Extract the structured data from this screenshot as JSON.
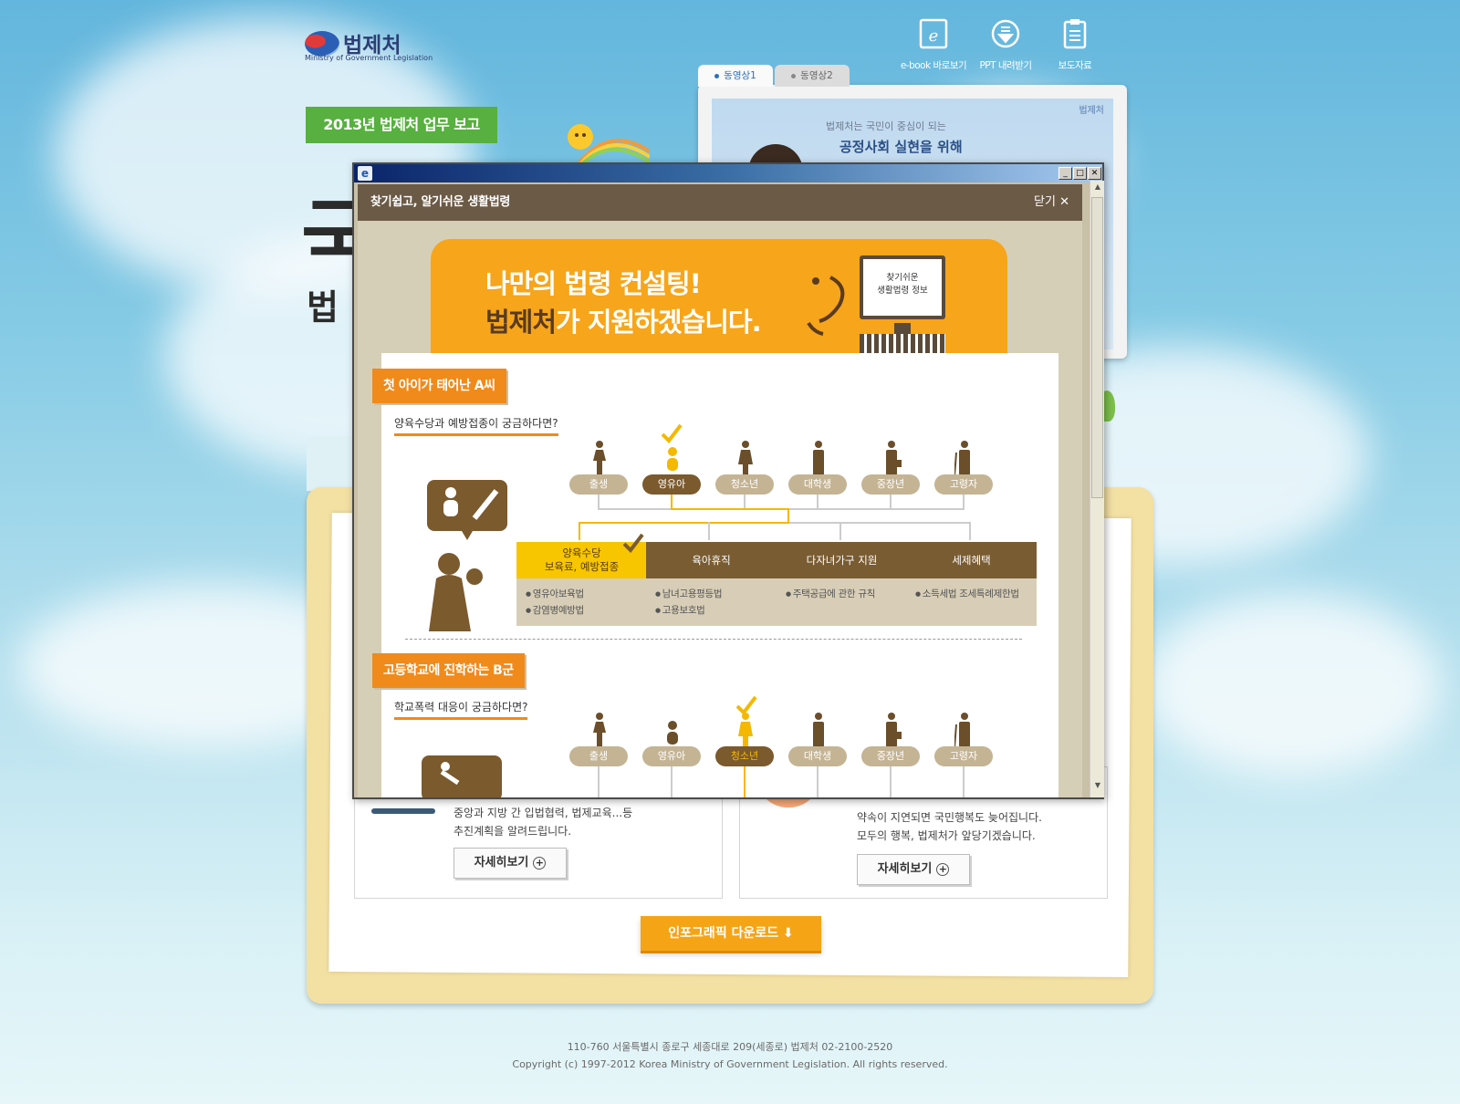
{
  "header": {
    "logo_name": "법제처",
    "logo_sub": "Ministry of Government Legislation",
    "buttons": [
      {
        "label": "e-book 바로보기",
        "icon": "ebook-icon"
      },
      {
        "label": "PPT 내려받기",
        "icon": "download-icon"
      },
      {
        "label": "보도자료",
        "icon": "clipboard-icon"
      }
    ],
    "report_badge": "2013년 법제처 업무 보고"
  },
  "video": {
    "tabs": [
      "동영상1",
      "동영상2"
    ],
    "line1": "법제처는 국민이 중심이 되는",
    "line2": "공정사회 실현을 위해",
    "logo": "법제처"
  },
  "popup": {
    "title": "찾기쉽고, 알기쉬운 생활법령",
    "close": "닫기",
    "banner": {
      "line1": "나만의 법령 컨설팅!",
      "line2_highlight": "법제처",
      "line2_rest": "가 지원하겠습니다.",
      "monitor_text": "찾기쉬운\n생활법령 정보"
    },
    "section_a": {
      "tag": "첫 아이가 태어난 A씨",
      "question": "양육수당과 예방접종이 궁금하다면?",
      "stages": [
        "출생",
        "영유아",
        "청소년",
        "대학생",
        "중장년",
        "고령자"
      ],
      "benefits": [
        {
          "head": "양육수당\n보육료, 예방접종",
          "items": [
            "영유아보육법",
            "감염병예방법"
          ]
        },
        {
          "head": "육아휴직",
          "items": [
            "남녀고용평등법",
            "고용보호법"
          ]
        },
        {
          "head": "다자녀가구 지원",
          "items": [
            "주택공급에 관한 규칙"
          ]
        },
        {
          "head": "세제혜택",
          "items": [
            "소득세법 조세특례제한법"
          ]
        }
      ]
    },
    "section_b": {
      "tag": "고등학교에 진학하는 B군",
      "question": "학교폭력 대응이 궁금하다면?",
      "stages": [
        "출생",
        "영유아",
        "청소년",
        "대학생",
        "중장년",
        "고령자"
      ]
    }
  },
  "cards": {
    "left": {
      "line1": "중앙과 지방 간 입법협력, 법제교육...등",
      "line2": "추진계획을 알려드립니다.",
      "button": "자세히보기"
    },
    "right": {
      "line1": "약속이 지연되면 국민행복도 늦어집니다.",
      "line2": "모두의 행복, 법제처가 앞당기겠습니다.",
      "button": "자세히보기"
    }
  },
  "download_button": "인포그래픽 다운로드",
  "footer": {
    "address": "110-760 서울특별시 종로구 세종대로 209(세종로) 법제처 02-2100-2520",
    "copyright": "Copyright (c) 1997-2012 Korea Ministry of Government Legislation. All rights reserved."
  },
  "colors": {
    "accent_orange": "#f08a1a",
    "brown": "#6b5a46",
    "green": "#57b03f",
    "yellow": "#f5b800"
  }
}
